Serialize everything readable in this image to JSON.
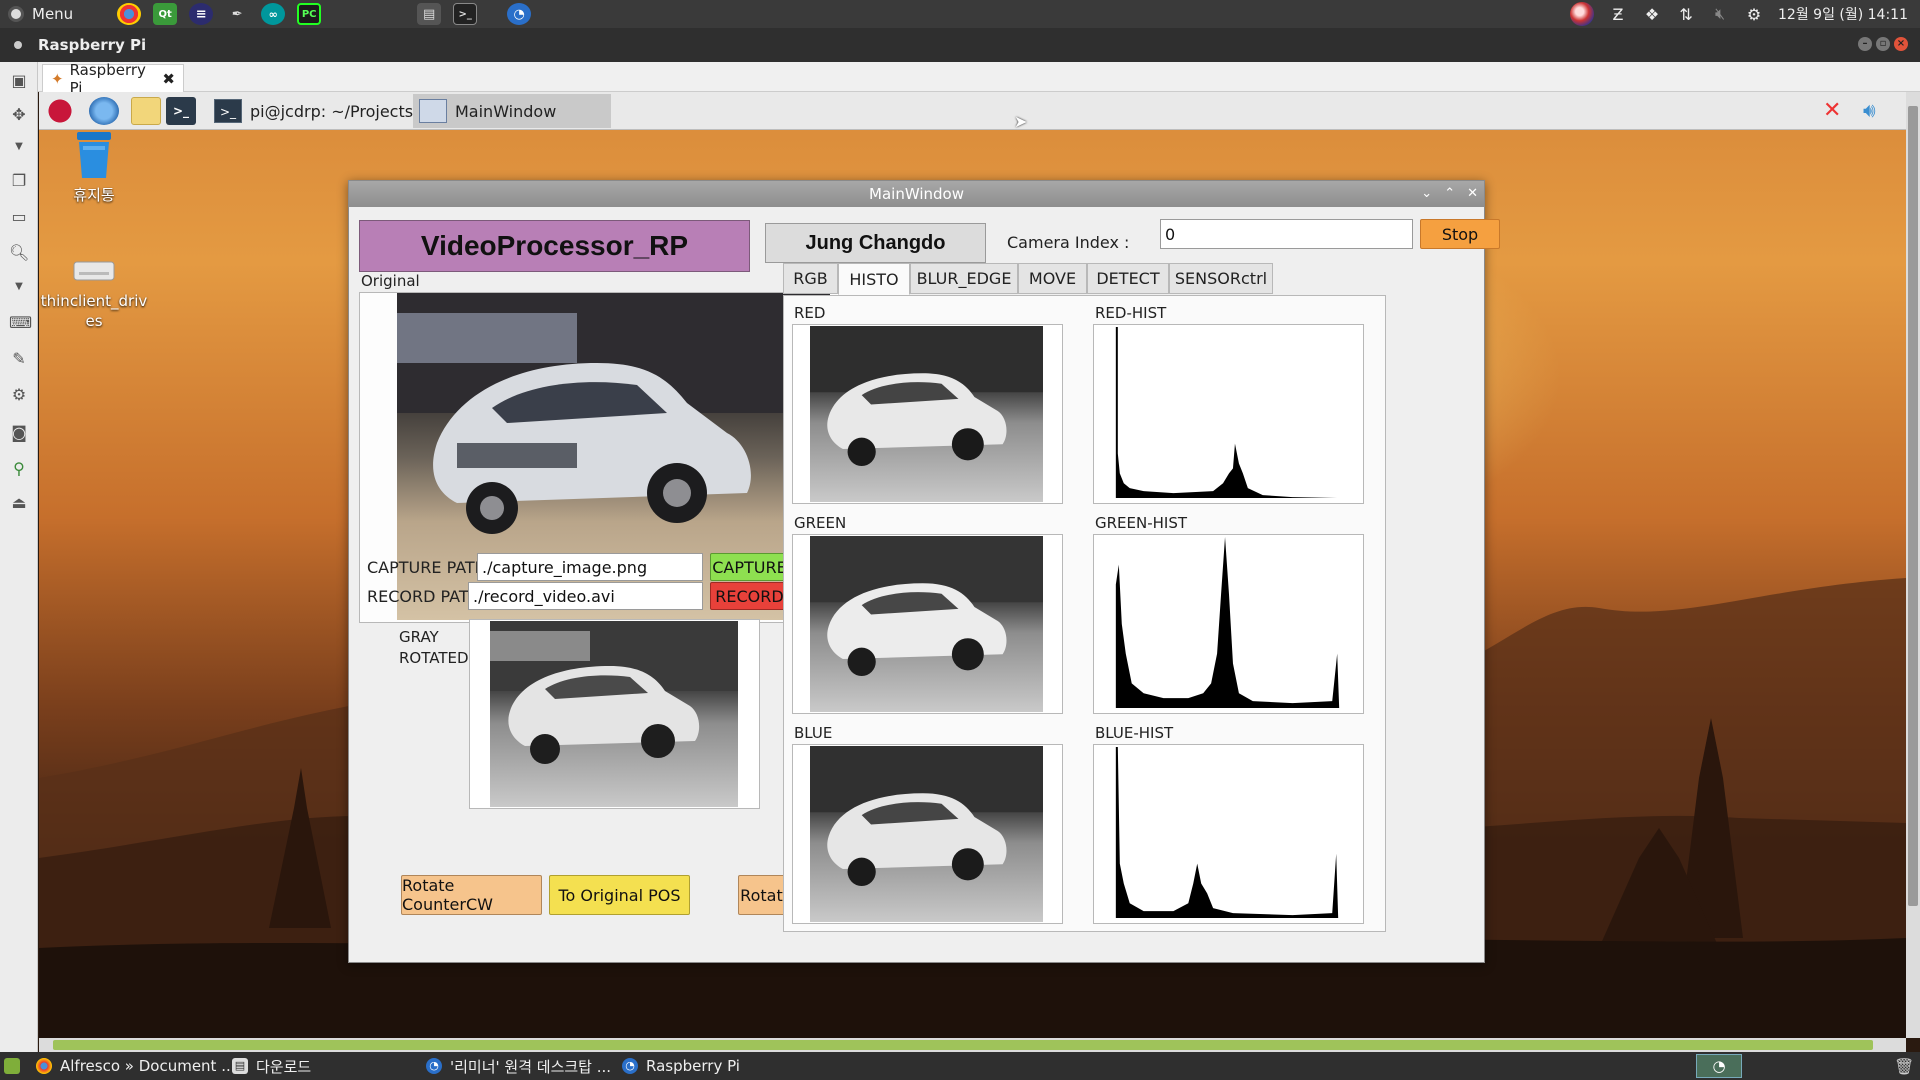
{
  "host_panel": {
    "menu_label": "Menu",
    "clock": "12월 9일 (월) 14:11"
  },
  "viewer": {
    "title": "Raspberry Pi",
    "tab_label": "Raspberry Pi"
  },
  "remote_panel": {
    "tasks": [
      {
        "label": "pi@jcdrp: ~/Projects/..."
      },
      {
        "label": "MainWindow"
      }
    ]
  },
  "desktop_icons": [
    {
      "label": "휴지통"
    },
    {
      "label": "thinclient_drives"
    }
  ],
  "app": {
    "window_title": "MainWindow",
    "banner": "VideoProcessor_RP",
    "author": "Jung Changdo",
    "camera_index_label": "Camera Index :",
    "camera_index_value": "0",
    "stop_button": "Stop",
    "original_label": "Original",
    "capture_path_label": "CAPTURE PATH :",
    "capture_path_value": "./capture_image.png",
    "capture_button": "CAPTURE",
    "record_path_label": "RECORD PATH :",
    "record_path_value": "./record_video.avi",
    "record_button": "RECORD",
    "gray_label_line1": "GRAY",
    "gray_label_line2": "ROTATED",
    "rotate_ccw_button": "Rotate CounterCW",
    "original_pos_button": "To Original POS",
    "rotate_cw_button": "Rotate Clockwise",
    "tabs": [
      "RGB",
      "HISTO",
      "BLUR_EDGE",
      "MOVE",
      "DETECT",
      "SENSORctrl"
    ],
    "active_tab": "HISTO",
    "histo_panels": {
      "red": "RED",
      "red_hist": "RED-HIST",
      "green": "GREEN",
      "green_hist": "GREEN-HIST",
      "blue": "BLUE",
      "blue_hist": "BLUE-HIST"
    }
  },
  "colors": {
    "banner_bg": "#b87fb6",
    "stop_bg": "#f5a040",
    "capture_bg": "#8ee050",
    "record_bg": "#e8413a",
    "rotate_side_bg": "#f6c48c",
    "original_pos_bg": "#f4e050"
  },
  "host_taskbar": {
    "items": [
      {
        "label": "Alfresco » Document ..."
      },
      {
        "label": "다운로드"
      },
      {
        "label": "'리미너' 원격 데스크탑 ..."
      },
      {
        "label": "Raspberry Pi"
      }
    ]
  }
}
